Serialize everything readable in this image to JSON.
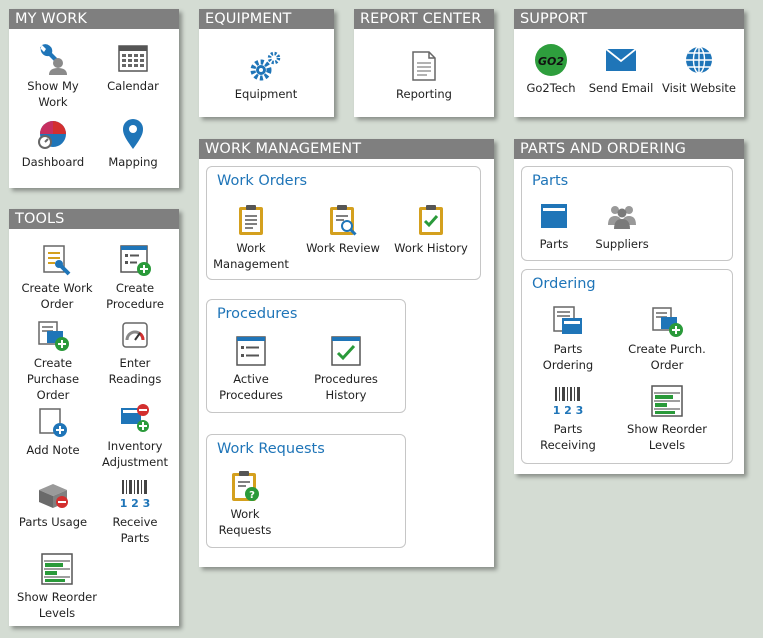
{
  "colors": {
    "background": "#d4dcd3",
    "header": "#7f7f7f",
    "accent": "#1f75b8",
    "green": "#2a9a3a",
    "red": "#d32f2f",
    "gold": "#d4a01e"
  },
  "my_work": {
    "title": "MY WORK",
    "show_my_work": "Show My\nWork",
    "calendar": "Calendar",
    "dashboard": "Dashboard",
    "mapping": "Mapping"
  },
  "tools": {
    "title": "TOOLS",
    "create_work_order": "Create Work\nOrder",
    "create_procedure": "Create\nProcedure",
    "create_purchase_order": "Create\nPurchase\nOrder",
    "enter_readings": "Enter\nReadings",
    "add_note": "Add Note",
    "inventory_adjustment": "Inventory\nAdjustment",
    "parts_usage": "Parts Usage",
    "receive_parts": "Receive\nParts",
    "show_reorder_levels": "Show Reorder\nLevels"
  },
  "equipment": {
    "title": "EQUIPMENT",
    "equipment": "Equipment"
  },
  "report_center": {
    "title": "REPORT CENTER",
    "reporting": "Reporting"
  },
  "support": {
    "title": "SUPPORT",
    "go2tech": "Go2Tech",
    "go2tech_logo": "GO2",
    "send_email": "Send Email",
    "visit_website": "Visit Website"
  },
  "work_management": {
    "title": "WORK MANAGEMENT",
    "work_orders": {
      "title": "Work Orders",
      "work_management": "Work\nManagement",
      "work_review": "Work Review",
      "work_history": "Work History"
    },
    "procedures": {
      "title": "Procedures",
      "active_procedures": "Active\nProcedures",
      "procedures_history": "Procedures\nHistory"
    },
    "work_requests": {
      "title": "Work Requests",
      "work_requests": "Work\nRequests"
    }
  },
  "parts_and_ordering": {
    "title": "PARTS AND ORDERING",
    "parts_group": {
      "title": "Parts",
      "parts": "Parts",
      "suppliers": "Suppliers"
    },
    "ordering_group": {
      "title": "Ordering",
      "parts_ordering": "Parts\nOrdering",
      "create_purch_order": "Create Purch.\nOrder",
      "parts_receiving": "Parts\nReceiving",
      "show_reorder_levels": "Show Reorder\nLevels",
      "barcode_digits": "1 2 3"
    }
  }
}
